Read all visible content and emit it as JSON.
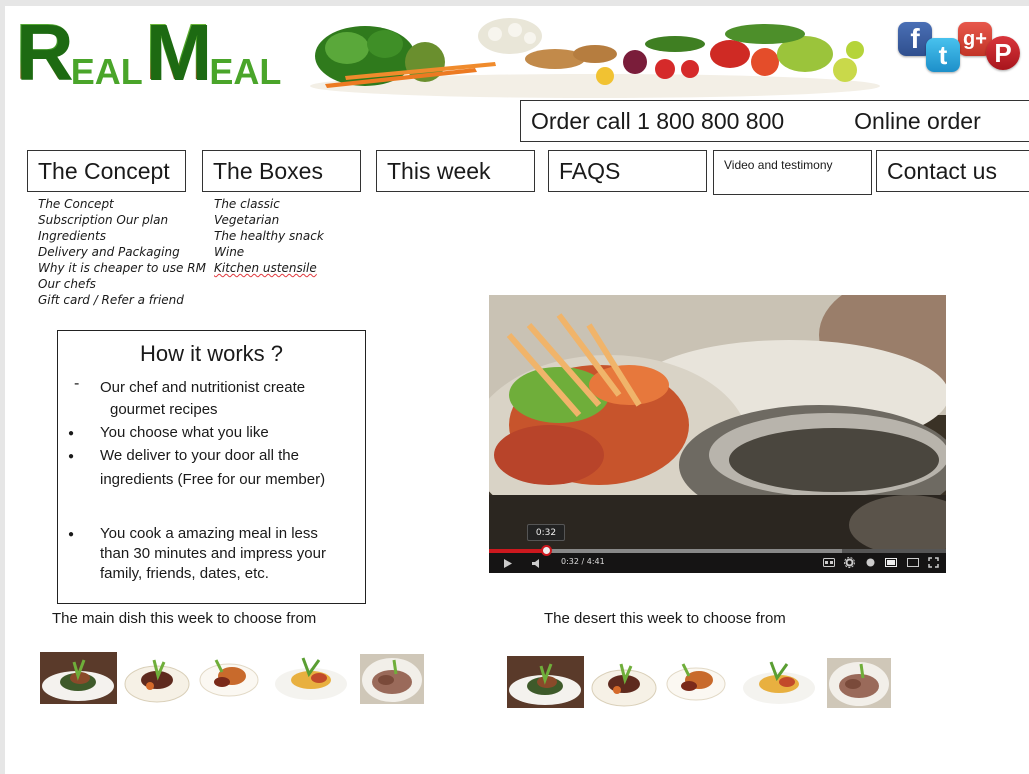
{
  "header": {
    "logo_parts": [
      "R",
      "EAL",
      "M",
      "EAL"
    ],
    "social_icons": [
      "facebook-icon",
      "twitter-icon",
      "google-plus-icon",
      "pinterest-icon"
    ],
    "social_glyphs": [
      "f",
      "t",
      "g+",
      "P"
    ]
  },
  "order": {
    "call_label": "Order call 1 800 800 800",
    "online_label": "Online order"
  },
  "nav": {
    "concept": "The Concept",
    "boxes": "The Boxes",
    "this_week": "This week",
    "faqs": "FAQS",
    "video": "Video and testimony",
    "contact": "Contact us"
  },
  "concept_menu": [
    "The Concept",
    "Subscription Our plan",
    "Ingredients",
    "Delivery and Packaging",
    "Why it is cheaper to use RM",
    "Our chefs",
    "Gift card / Refer a friend"
  ],
  "boxes_menu": [
    "The classic",
    "Vegetarian",
    "The healthy snack",
    "Wine",
    "Kitchen ustensile"
  ],
  "how": {
    "title": "How it works ?",
    "items": [
      "Our chef and nutritionist create",
      "gourmet recipes",
      "You choose what you like",
      "We deliver to your door all the",
      "ingredients (Free for our member)",
      "You cook a amazing meal in less",
      "than 30 minutes  and impress your",
      "family, friends, dates, etc."
    ]
  },
  "video": {
    "tooltip": "0:32",
    "time": "0:32 / 4:41",
    "progress": 0.125
  },
  "captions": {
    "main": "The main dish this week to choose from",
    "dessert": "The desert this week to choose from"
  },
  "colors": {
    "logo_green": "#3c9a23",
    "progress_red": "#cc181e"
  }
}
